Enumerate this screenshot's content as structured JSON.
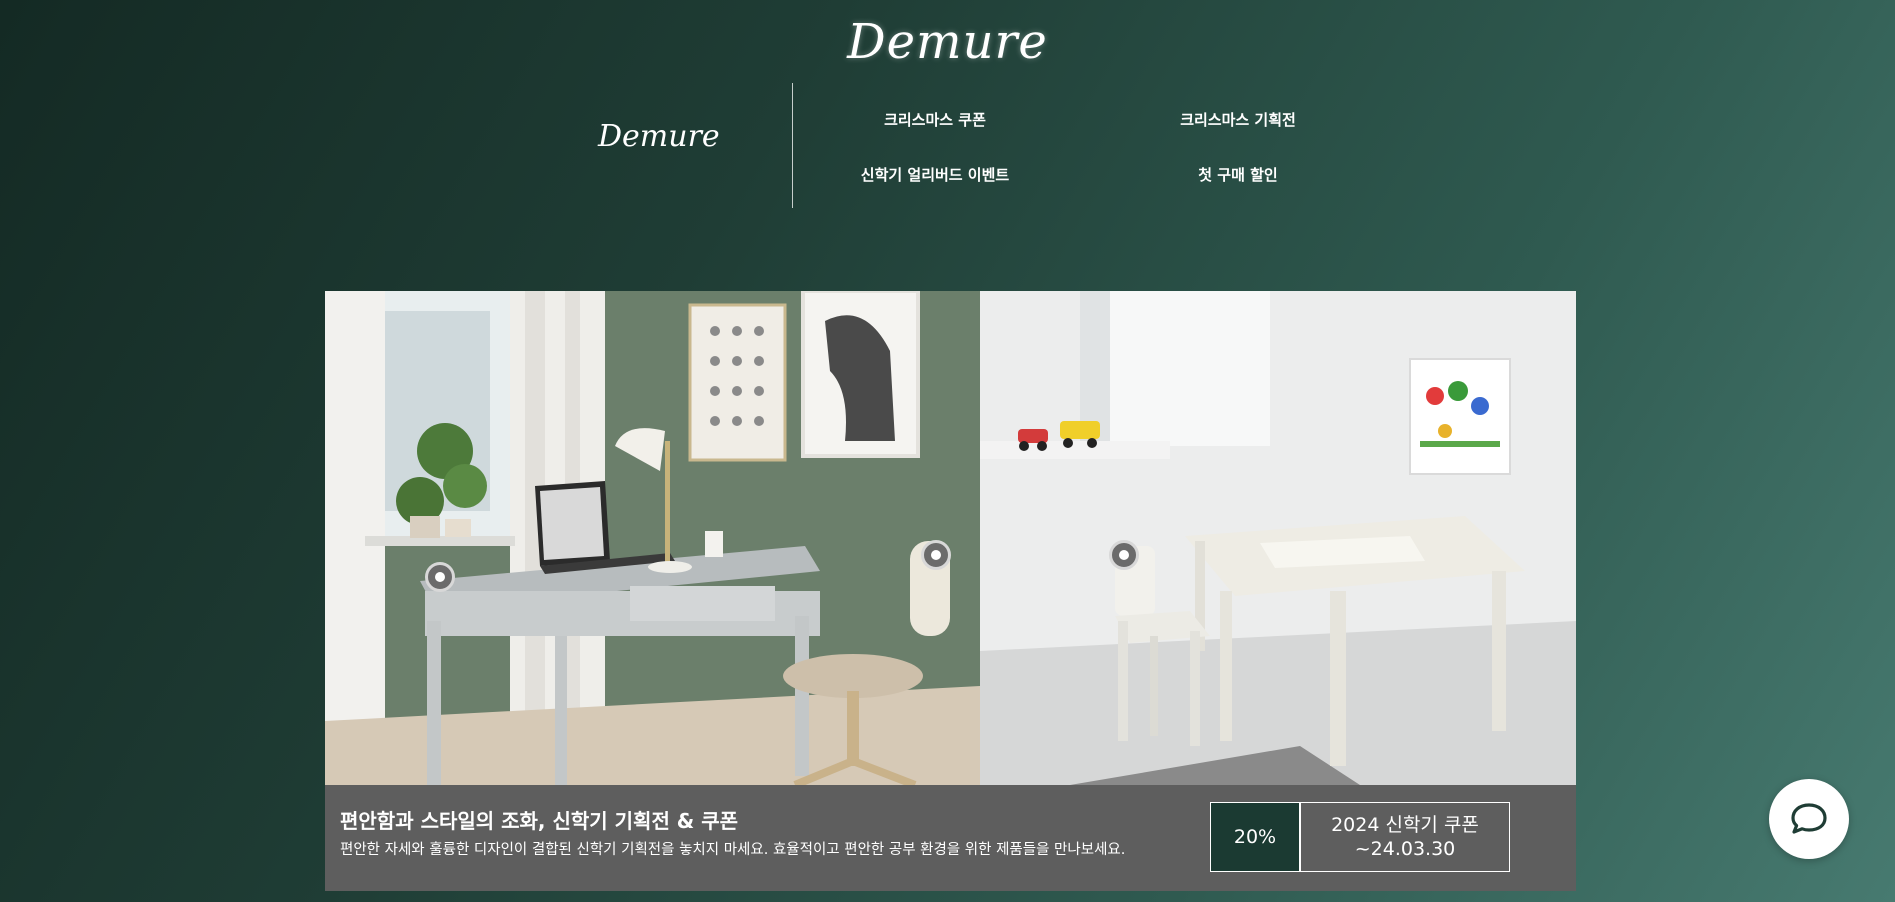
{
  "brand": {
    "logo_text": "Demure",
    "menu_logo_text": "Demure"
  },
  "menu": {
    "items": [
      {
        "label": "크리스마스 쿠폰"
      },
      {
        "label": "크리스마스 기획전"
      },
      {
        "label": "신학기 얼리버드 이벤트"
      },
      {
        "label": "첫 구매 할인"
      }
    ]
  },
  "banner": {
    "title": "편안함과 스타일의 조화, 신학기 기획전 & 쿠폰",
    "description": "편안한 자세와 훌륭한 디자인이 결합된 신학기 기획전을 놓치지 마세요. 효율적이고 편안한 공부 환경을 위한 제품들을 만나보세요.",
    "coupon": {
      "discount": "20%",
      "name": "2024 신학기 쿠폰",
      "expiry": "~24.03.30"
    }
  },
  "icons": {
    "chat": "chat-bubble-icon",
    "hotspot": "product-hotspot-icon"
  },
  "colors": {
    "accent_dark_green": "#1b3a32",
    "info_bar_gray": "#5e5e5e"
  }
}
